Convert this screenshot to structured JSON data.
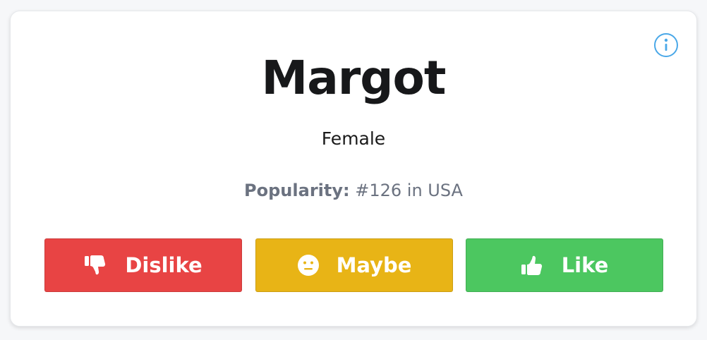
{
  "card": {
    "name": "Margot",
    "gender": "Female",
    "popularity_label": "Popularity:",
    "popularity_value": "#126 in USA"
  },
  "actions": {
    "dislike_label": "Dislike",
    "maybe_label": "Maybe",
    "like_label": "Like"
  },
  "icons": {
    "info": "info-circle-icon",
    "dislike": "thumbs-down-icon",
    "maybe": "neutral-face-icon",
    "like": "thumbs-up-icon"
  },
  "colors": {
    "dislike": "#e84444",
    "maybe": "#e8b416",
    "like": "#4cc760",
    "info": "#4aa8e8"
  }
}
